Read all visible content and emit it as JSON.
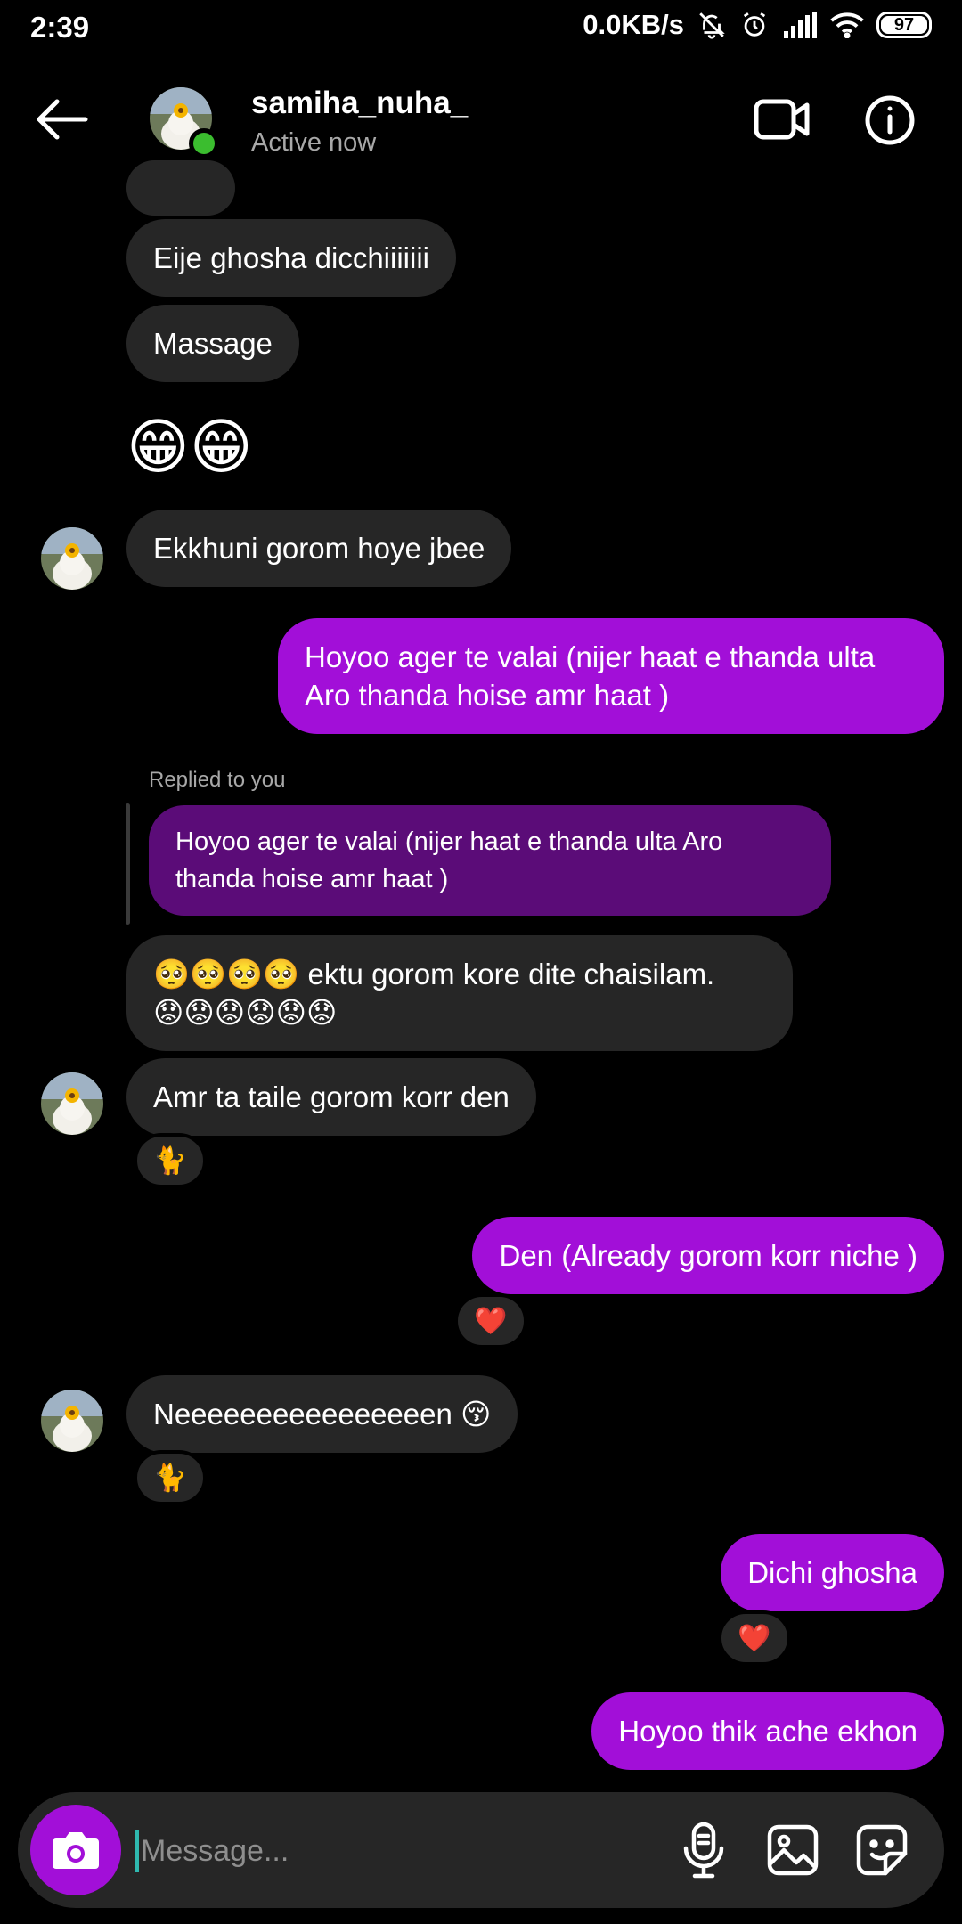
{
  "status_bar": {
    "time": "2:39",
    "speed": "0.0KB/s",
    "battery": "97"
  },
  "header": {
    "username": "samiha_nuha_",
    "status": "Active now"
  },
  "messages": [
    {
      "text": "Eije ghosha dicchiiiiiii"
    },
    {
      "text": "Massage"
    },
    {
      "text": "😁😁"
    },
    {
      "text": "Ekkhuni gorom hoye jbee"
    },
    {
      "text1": "Hoyoo ager te valai (nijer haat e thanda ulta",
      "text2": "Aro thanda hoise amr haat  )"
    },
    {
      "label": "Replied to you",
      "quote1": "Hoyoo ager te valai (nijer haat e thanda ulta Aro",
      "quote2": "thanda hoise amr haat  )"
    },
    {
      "text1": "🥺🥺🥺🥺 ektu gorom kore dite chaisilam.",
      "text2": "😟😟😟😟😟😟"
    },
    {
      "text": "Amr ta taile gorom korr den",
      "reaction": "🐈"
    },
    {
      "text": "Den (Already gorom korr niche )",
      "reaction": "❤️"
    },
    {
      "text": "Neeeeeeeeeeeeeeeen 😚",
      "reaction": "🐈"
    },
    {
      "text": "Dichi ghosha",
      "reaction": "❤️"
    },
    {
      "text": "Hoyoo thik ache ekhon"
    }
  ],
  "composer": {
    "placeholder": "Message..."
  },
  "icons": {
    "back": "arrow-left-icon",
    "video": "video-camera-icon",
    "info": "info-icon",
    "camera": "camera-icon",
    "mic": "microphone-icon",
    "gallery": "image-icon",
    "sticker": "sticker-icon"
  }
}
